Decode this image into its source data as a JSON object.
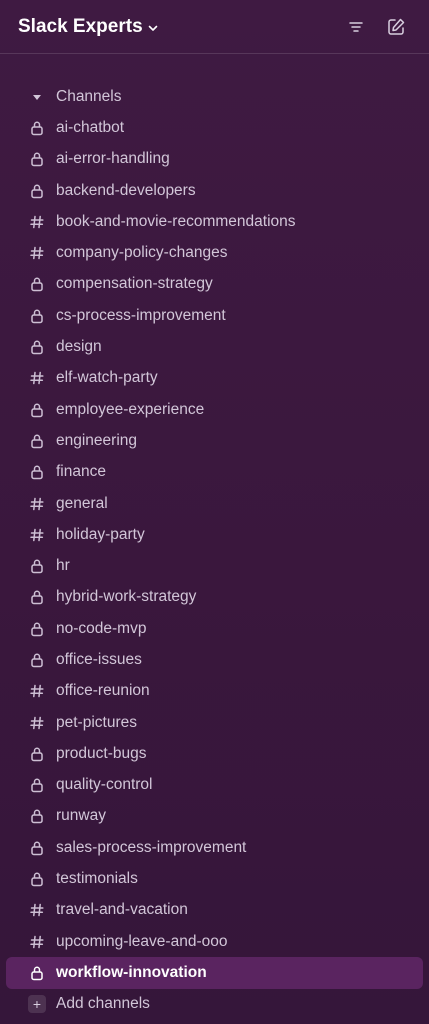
{
  "workspace": {
    "name": "Slack Experts"
  },
  "sections": {
    "channels_label": "Channels",
    "add_channels_label": "Add channels"
  },
  "channels": [
    {
      "name": "ai-chatbot",
      "private": true
    },
    {
      "name": "ai-error-handling",
      "private": true
    },
    {
      "name": "backend-developers",
      "private": true
    },
    {
      "name": "book-and-movie-recommendations",
      "private": false
    },
    {
      "name": "company-policy-changes",
      "private": false
    },
    {
      "name": "compensation-strategy",
      "private": true
    },
    {
      "name": "cs-process-improvement",
      "private": true
    },
    {
      "name": "design",
      "private": true
    },
    {
      "name": "elf-watch-party",
      "private": false
    },
    {
      "name": "employee-experience",
      "private": true
    },
    {
      "name": "engineering",
      "private": true
    },
    {
      "name": "finance",
      "private": true
    },
    {
      "name": "general",
      "private": false
    },
    {
      "name": "holiday-party",
      "private": false
    },
    {
      "name": "hr",
      "private": true
    },
    {
      "name": "hybrid-work-strategy",
      "private": true
    },
    {
      "name": "no-code-mvp",
      "private": true
    },
    {
      "name": "office-issues",
      "private": true
    },
    {
      "name": "office-reunion",
      "private": false
    },
    {
      "name": "pet-pictures",
      "private": false
    },
    {
      "name": "product-bugs",
      "private": true
    },
    {
      "name": "quality-control",
      "private": true
    },
    {
      "name": "runway",
      "private": true
    },
    {
      "name": "sales-process-improvement",
      "private": true
    },
    {
      "name": "testimonials",
      "private": true
    },
    {
      "name": "travel-and-vacation",
      "private": false
    },
    {
      "name": "upcoming-leave-and-ooo",
      "private": false
    },
    {
      "name": "workflow-innovation",
      "private": true,
      "selected": true
    }
  ],
  "colors": {
    "sidebar_bg": "#3f1a42",
    "selected_bg": "#5a2460",
    "text": "#d2c6d8"
  }
}
